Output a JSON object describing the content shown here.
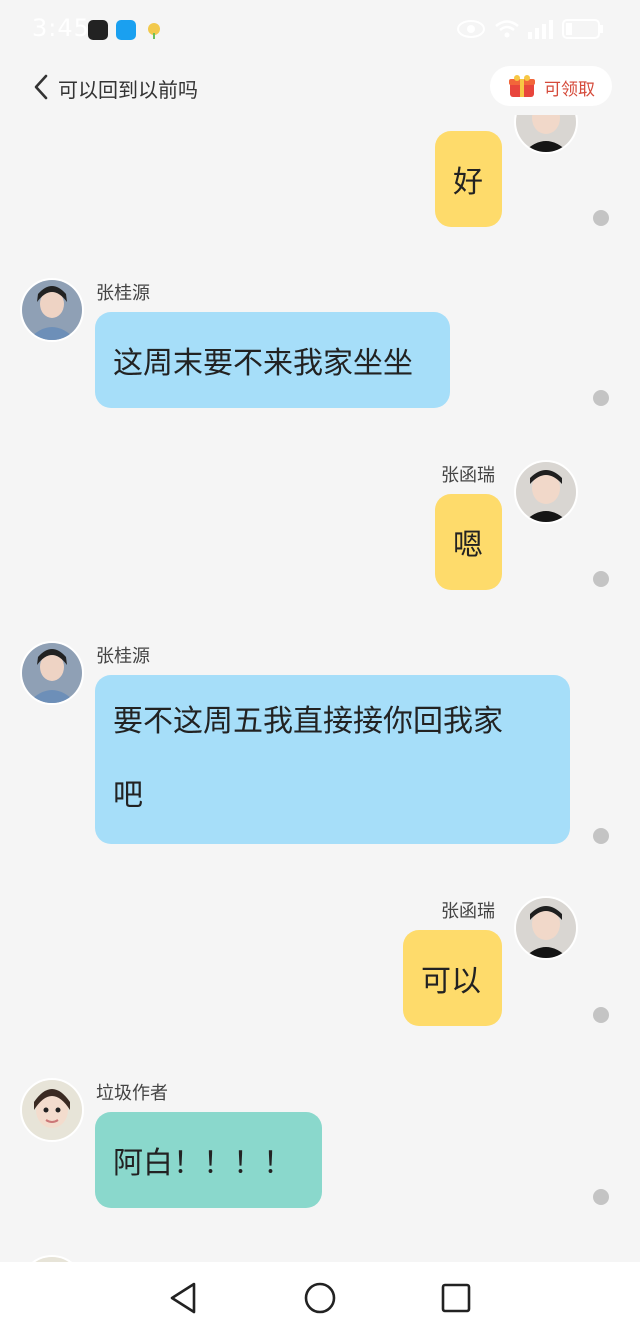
{
  "status_bar": {
    "time": "3:45"
  },
  "header": {
    "back_icon": "chevron-left-icon",
    "title": "可以回到以前吗",
    "reward_label": "可领取",
    "reward_icon": "gift-icon"
  },
  "messages": [
    {
      "side": "right",
      "sender": "",
      "text": "好"
    },
    {
      "side": "left",
      "sender": "张桂源",
      "text": "这周末要不来我家坐坐"
    },
    {
      "side": "right",
      "sender": "张函瑞",
      "text": "嗯"
    },
    {
      "side": "left",
      "sender": "张桂源",
      "text_line1": "要不这周五我直接接你回我家",
      "text_line2": "吧"
    },
    {
      "side": "right",
      "sender": "张函瑞",
      "text": "可以"
    },
    {
      "side": "left",
      "sender": "垃圾作者",
      "text": "阿白！！！！"
    }
  ],
  "nav": {
    "back": "triangle-back-icon",
    "home": "circle-home-icon",
    "recents": "square-recents-icon"
  },
  "colors": {
    "right_bubble": "#fedb6b",
    "left_bubble_blue": "#a6def9",
    "left_bubble_teal": "#8ad8cc",
    "background": "#f5f5f5"
  }
}
